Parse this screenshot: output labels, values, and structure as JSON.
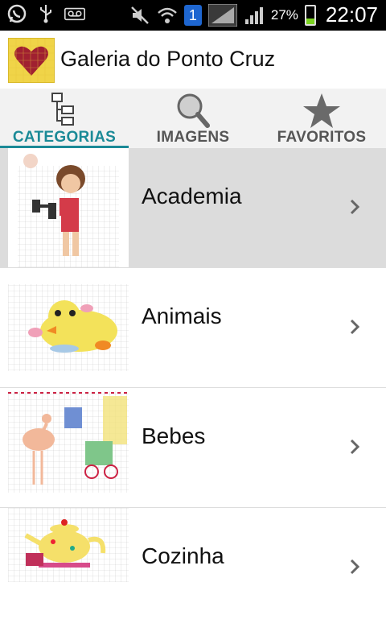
{
  "status_bar": {
    "battery_percent": "27%",
    "time": "22:07",
    "notification_count": "1"
  },
  "app": {
    "title": "Galeria do Ponto Cruz"
  },
  "tabs": [
    {
      "label": "CATEGORIAS",
      "icon": "tree-icon",
      "selected": true
    },
    {
      "label": "IMAGENS",
      "icon": "search-icon",
      "selected": false
    },
    {
      "label": "FAVORITOS",
      "icon": "star-icon",
      "selected": false
    }
  ],
  "categories": [
    {
      "label": "Academia",
      "selected": true
    },
    {
      "label": "Animais",
      "selected": false
    },
    {
      "label": "Bebes",
      "selected": false
    },
    {
      "label": "Cozinha",
      "selected": false
    }
  ],
  "colors": {
    "accent": "#1b8a97",
    "statusbar": "#000000",
    "selected_row": "#dcdcdc"
  }
}
